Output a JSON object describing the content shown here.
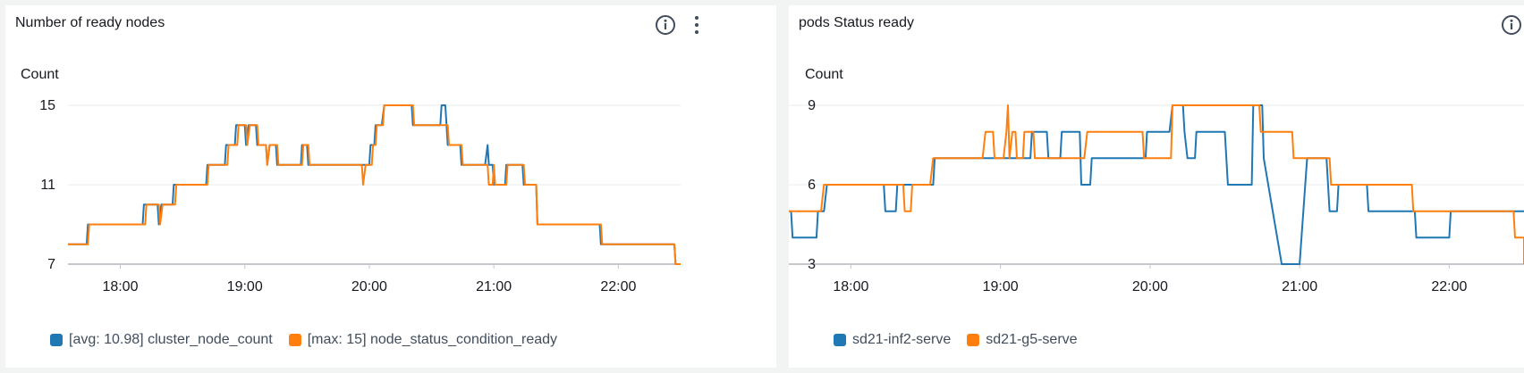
{
  "icons": {
    "info": "info-circle-icon",
    "menu": "vertical-ellipsis-icon"
  },
  "colors": {
    "blue": "#1f77b4",
    "orange": "#ff7f0e",
    "grid": "#e9ebed",
    "baseline": "#c6c6cd"
  },
  "chart_data": [
    {
      "type": "line",
      "title": "Number of ready nodes",
      "ylabel": "Count",
      "ylim": [
        7,
        15
      ],
      "yticks": [
        7,
        11,
        15
      ],
      "xlim": [
        17.58,
        22.5
      ],
      "xticks": [
        18,
        19,
        20,
        21,
        22
      ],
      "xtick_labels": [
        "18:00",
        "19:00",
        "20:00",
        "21:00",
        "22:00"
      ],
      "grid": true,
      "legend_position": "bottom-left",
      "series": [
        {
          "name": "[avg: 10.98] cluster_node_count",
          "color": "#1f77b4",
          "points": [
            [
              17.58,
              8
            ],
            [
              17.73,
              8
            ],
            [
              17.74,
              9
            ],
            [
              18.18,
              9
            ],
            [
              18.19,
              10
            ],
            [
              18.3,
              10
            ],
            [
              18.31,
              9
            ],
            [
              18.33,
              10
            ],
            [
              18.42,
              10
            ],
            [
              18.43,
              11
            ],
            [
              18.69,
              11
            ],
            [
              18.7,
              12
            ],
            [
              18.84,
              12
            ],
            [
              18.85,
              13
            ],
            [
              18.92,
              13
            ],
            [
              18.93,
              14
            ],
            [
              19,
              14
            ],
            [
              19.01,
              13
            ],
            [
              19.03,
              14
            ],
            [
              19.09,
              14
            ],
            [
              19.1,
              13
            ],
            [
              19.17,
              13
            ],
            [
              19.18,
              12
            ],
            [
              19.2,
              13
            ],
            [
              19.25,
              13
            ],
            [
              19.26,
              12
            ],
            [
              19.45,
              12
            ],
            [
              19.46,
              13
            ],
            [
              19.5,
              13
            ],
            [
              19.51,
              12
            ],
            [
              20,
              12
            ],
            [
              20.01,
              13
            ],
            [
              20.04,
              13
            ],
            [
              20.05,
              14
            ],
            [
              20.1,
              14
            ],
            [
              20.12,
              15
            ],
            [
              20.34,
              15
            ],
            [
              20.35,
              14
            ],
            [
              20.57,
              14
            ],
            [
              20.58,
              15
            ],
            [
              20.61,
              15
            ],
            [
              20.62,
              14
            ],
            [
              20.63,
              13
            ],
            [
              20.73,
              13
            ],
            [
              20.74,
              12
            ],
            [
              20.93,
              12
            ],
            [
              20.95,
              13
            ],
            [
              20.96,
              12
            ],
            [
              20.99,
              12
            ],
            [
              21,
              11
            ],
            [
              21.09,
              11
            ],
            [
              21.1,
              12
            ],
            [
              21.23,
              12
            ],
            [
              21.24,
              11
            ],
            [
              21.34,
              11
            ],
            [
              21.35,
              9
            ],
            [
              21.85,
              9
            ],
            [
              21.86,
              8
            ],
            [
              22.45,
              8
            ],
            [
              22.46,
              7
            ],
            [
              22.5,
              7
            ]
          ]
        },
        {
          "name": "[max: 15] node_status_condition_ready",
          "color": "#ff7f0e",
          "points": [
            [
              17.58,
              8
            ],
            [
              17.74,
              8
            ],
            [
              17.75,
              9
            ],
            [
              18.2,
              9
            ],
            [
              18.21,
              10
            ],
            [
              18.31,
              10
            ],
            [
              18.32,
              9
            ],
            [
              18.34,
              10
            ],
            [
              18.44,
              10
            ],
            [
              18.45,
              11
            ],
            [
              18.7,
              11
            ],
            [
              18.71,
              12
            ],
            [
              18.86,
              12
            ],
            [
              18.87,
              13
            ],
            [
              18.94,
              13
            ],
            [
              18.95,
              14
            ],
            [
              19.01,
              14
            ],
            [
              19.02,
              13
            ],
            [
              19.04,
              14
            ],
            [
              19.1,
              14
            ],
            [
              19.11,
              13
            ],
            [
              19.17,
              13
            ],
            [
              19.18,
              12
            ],
            [
              19.2,
              13
            ],
            [
              19.26,
              13
            ],
            [
              19.27,
              12
            ],
            [
              19.46,
              12
            ],
            [
              19.47,
              13
            ],
            [
              19.51,
              13
            ],
            [
              19.52,
              12
            ],
            [
              19.94,
              12
            ],
            [
              19.95,
              11
            ],
            [
              19.97,
              12
            ],
            [
              20.02,
              12
            ],
            [
              20.03,
              13
            ],
            [
              20.05,
              13
            ],
            [
              20.06,
              14
            ],
            [
              20.11,
              14
            ],
            [
              20.12,
              15
            ],
            [
              20.35,
              15
            ],
            [
              20.36,
              14
            ],
            [
              20.63,
              14
            ],
            [
              20.64,
              13
            ],
            [
              20.74,
              13
            ],
            [
              20.75,
              12
            ],
            [
              20.95,
              12
            ],
            [
              20.96,
              11
            ],
            [
              20.99,
              11
            ],
            [
              21.0,
              12
            ],
            [
              21.01,
              11
            ],
            [
              21.1,
              11
            ],
            [
              21.11,
              12
            ],
            [
              21.24,
              12
            ],
            [
              21.25,
              11
            ],
            [
              21.34,
              11
            ],
            [
              21.35,
              9
            ],
            [
              21.86,
              9
            ],
            [
              21.87,
              8
            ],
            [
              22.45,
              8
            ],
            [
              22.46,
              7
            ],
            [
              22.5,
              7
            ]
          ]
        }
      ]
    },
    {
      "type": "line",
      "title": "pods Status ready",
      "ylabel": "Count",
      "ylim": [
        3,
        9
      ],
      "yticks": [
        3,
        6,
        9
      ],
      "xlim": [
        17.58,
        22.5
      ],
      "xticks": [
        18,
        19,
        20,
        21,
        22
      ],
      "xtick_labels": [
        "18:00",
        "19:00",
        "20:00",
        "21:00",
        "22:00"
      ],
      "grid": true,
      "legend_position": "bottom-left",
      "series": [
        {
          "name": "sd21-inf2-serve",
          "color": "#1f77b4",
          "points": [
            [
              17.58,
              5
            ],
            [
              17.6,
              5
            ],
            [
              17.61,
              4
            ],
            [
              17.77,
              4
            ],
            [
              17.78,
              5
            ],
            [
              17.82,
              5
            ],
            [
              17.84,
              6
            ],
            [
              18.22,
              6
            ],
            [
              18.23,
              5
            ],
            [
              18.3,
              5
            ],
            [
              18.31,
              6
            ],
            [
              18.55,
              6
            ],
            [
              18.56,
              7
            ],
            [
              19.2,
              7
            ],
            [
              19.21,
              8
            ],
            [
              19.31,
              8
            ],
            [
              19.32,
              7
            ],
            [
              19.4,
              7
            ],
            [
              19.41,
              8
            ],
            [
              19.53,
              8
            ],
            [
              19.54,
              6
            ],
            [
              19.6,
              6
            ],
            [
              19.61,
              7
            ],
            [
              19.97,
              7
            ],
            [
              19.98,
              8
            ],
            [
              20.13,
              8
            ],
            [
              20.15,
              9
            ],
            [
              20.22,
              9
            ],
            [
              20.23,
              8
            ],
            [
              20.25,
              7
            ],
            [
              20.3,
              7
            ],
            [
              20.31,
              8
            ],
            [
              20.5,
              8
            ],
            [
              20.52,
              6
            ],
            [
              20.68,
              6
            ],
            [
              20.69,
              9
            ],
            [
              20.75,
              9
            ],
            [
              20.76,
              7
            ],
            [
              20.88,
              3
            ],
            [
              21.0,
              3
            ],
            [
              21.05,
              7
            ],
            [
              21.18,
              7
            ],
            [
              21.2,
              5
            ],
            [
              21.25,
              5
            ],
            [
              21.26,
              6
            ],
            [
              21.45,
              6
            ],
            [
              21.46,
              5
            ],
            [
              21.77,
              5
            ],
            [
              21.78,
              4
            ],
            [
              22.0,
              4
            ],
            [
              22.01,
              5
            ],
            [
              22.5,
              5
            ]
          ]
        },
        {
          "name": "sd21-g5-serve",
          "color": "#ff7f0e",
          "points": [
            [
              17.58,
              5
            ],
            [
              17.8,
              5
            ],
            [
              17.82,
              6
            ],
            [
              18.35,
              6
            ],
            [
              18.36,
              5
            ],
            [
              18.4,
              5
            ],
            [
              18.41,
              6
            ],
            [
              18.53,
              6
            ],
            [
              18.55,
              7
            ],
            [
              18.88,
              7
            ],
            [
              18.9,
              8
            ],
            [
              18.95,
              8
            ],
            [
              18.96,
              7
            ],
            [
              19.02,
              7
            ],
            [
              19.04,
              8
            ],
            [
              19.05,
              9
            ],
            [
              19.06,
              7
            ],
            [
              19.08,
              8
            ],
            [
              19.1,
              8
            ],
            [
              19.11,
              7
            ],
            [
              19.15,
              7
            ],
            [
              19.16,
              8
            ],
            [
              19.22,
              8
            ],
            [
              19.23,
              7
            ],
            [
              19.56,
              7
            ],
            [
              19.58,
              8
            ],
            [
              19.95,
              8
            ],
            [
              19.96,
              7
            ],
            [
              20.14,
              7
            ],
            [
              20.15,
              9
            ],
            [
              20.73,
              9
            ],
            [
              20.74,
              8
            ],
            [
              20.95,
              8
            ],
            [
              20.96,
              7
            ],
            [
              21.2,
              7
            ],
            [
              21.21,
              6
            ],
            [
              21.75,
              6
            ],
            [
              21.76,
              5
            ],
            [
              22.43,
              5
            ],
            [
              22.44,
              4
            ],
            [
              22.5,
              4
            ],
            [
              22.5,
              3
            ]
          ]
        }
      ]
    }
  ]
}
